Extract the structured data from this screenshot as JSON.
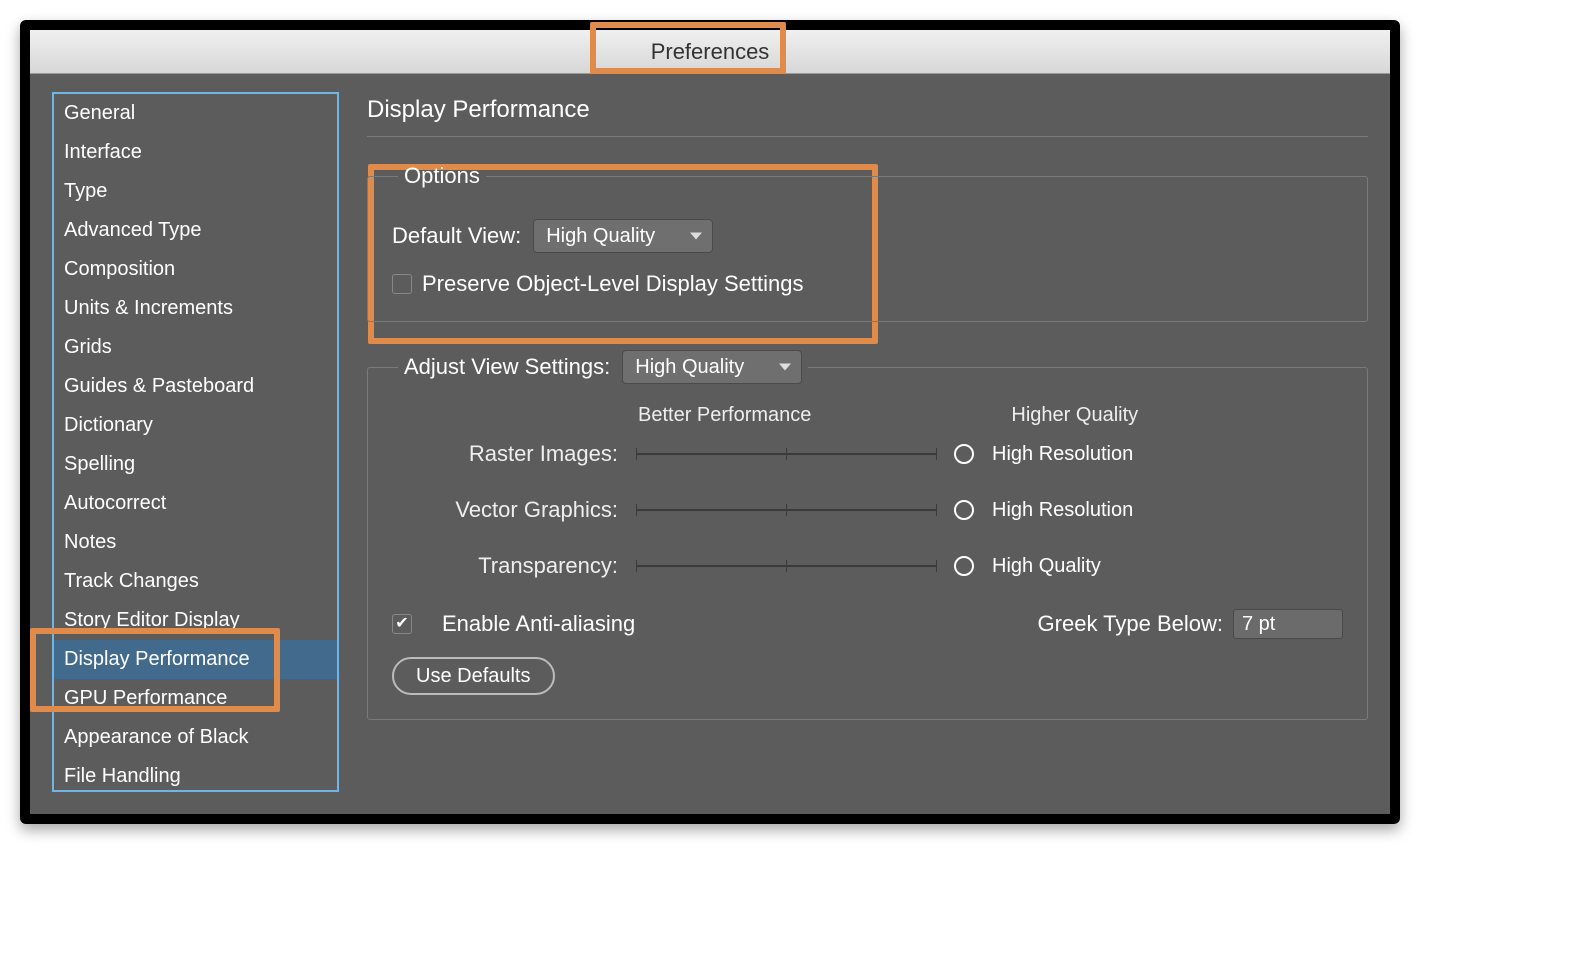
{
  "window": {
    "title": "Preferences"
  },
  "sidebar": {
    "items": [
      "General",
      "Interface",
      "Type",
      "Advanced Type",
      "Composition",
      "Units & Increments",
      "Grids",
      "Guides & Pasteboard",
      "Dictionary",
      "Spelling",
      "Autocorrect",
      "Notes",
      "Track Changes",
      "Story Editor Display",
      "Display Performance",
      "GPU Performance",
      "Appearance of Black",
      "File Handling"
    ],
    "active_index": 14
  },
  "panel": {
    "title": "Display Performance",
    "options": {
      "legend": "Options",
      "default_view_label": "Default View:",
      "default_view_value": "High Quality",
      "preserve_label": "Preserve Object-Level Display Settings",
      "preserve_checked": false
    },
    "adjust": {
      "legend": "Adjust View Settings:",
      "adjust_value": "High Quality",
      "perf_label": "Better Performance",
      "qual_label": "Higher Quality",
      "sliders": [
        {
          "label": "Raster Images:",
          "value": "High Resolution"
        },
        {
          "label": "Vector Graphics:",
          "value": "High Resolution"
        },
        {
          "label": "Transparency:",
          "value": "High Quality"
        }
      ],
      "anti_alias_label": "Enable Anti-aliasing",
      "anti_alias_checked": true,
      "greek_label": "Greek Type Below:",
      "greek_value": "7 pt",
      "use_defaults_label": "Use Defaults"
    }
  }
}
